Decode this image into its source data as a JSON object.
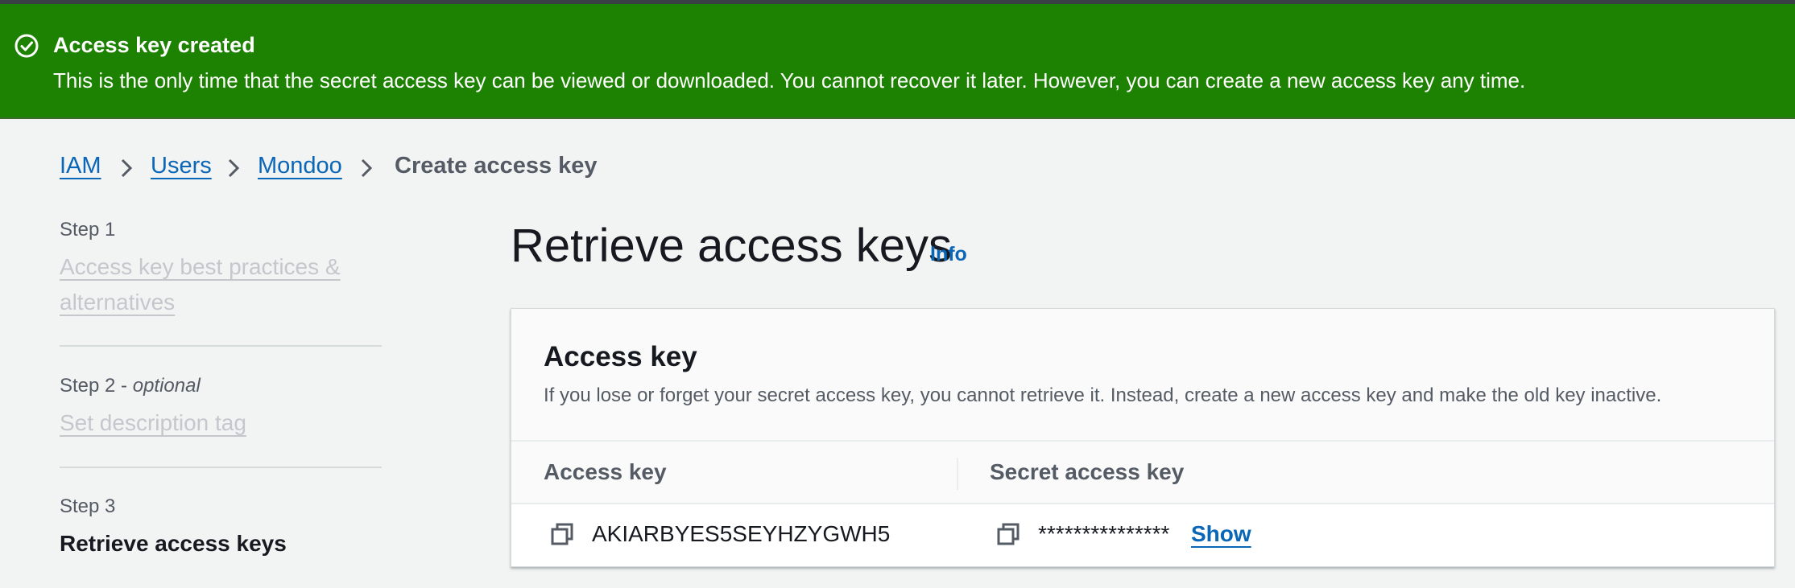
{
  "flash": {
    "title": "Access key created",
    "message": "This is the only time that the secret access key can be viewed or downloaded. You cannot recover it later. However, you can create a new access key any time.",
    "icon": "check-circle-icon",
    "color": "#1d8102"
  },
  "breadcrumb": {
    "items": [
      "IAM",
      "Users",
      "Mondoo"
    ],
    "current": "Create access key"
  },
  "steps": [
    {
      "label": "Step 1",
      "title": "Access key best practices & alternatives"
    },
    {
      "label": "Step 2",
      "label_suffix": "optional",
      "title": "Set description tag"
    },
    {
      "label": "Step 3",
      "title": "Retrieve access keys"
    }
  ],
  "page": {
    "title": "Retrieve access keys",
    "info_label": "Info"
  },
  "card": {
    "title": "Access key",
    "description": "If you lose or forget your secret access key, you cannot retrieve it. Instead, create a new access key and make the old key inactive.",
    "columns": [
      "Access key",
      "Secret access key"
    ],
    "row": {
      "access_key": "AKIARBYES5SEYHZYGWH5",
      "secret_masked": "***************",
      "show_label": "Show"
    }
  },
  "colors": {
    "link": "#0a66b7",
    "success": "#1d8102"
  }
}
